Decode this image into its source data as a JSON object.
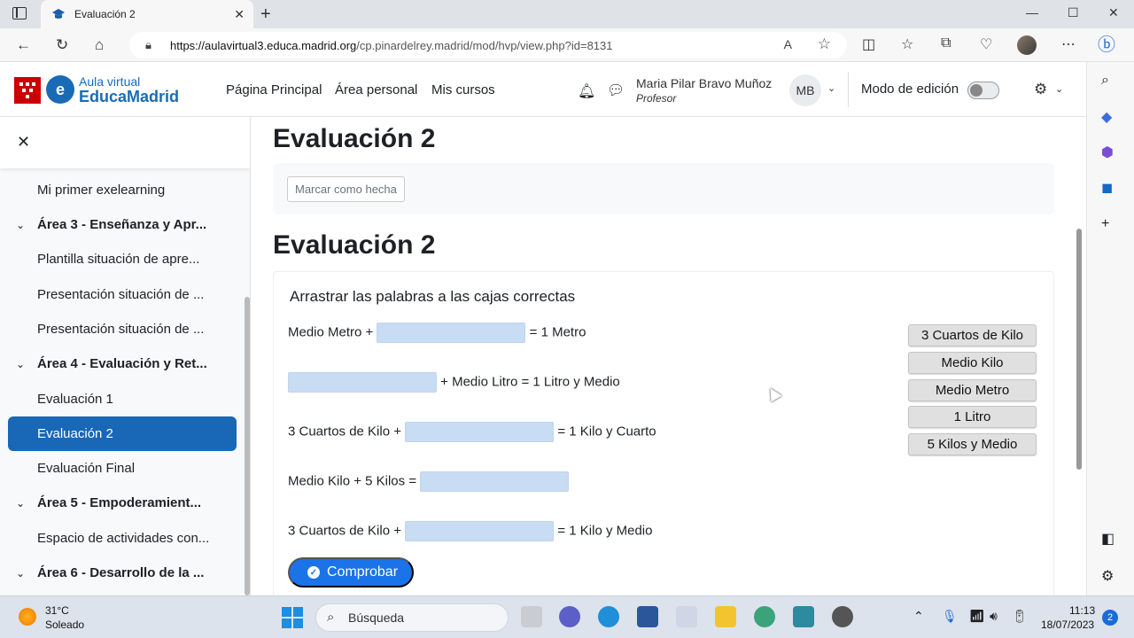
{
  "browser": {
    "tab_title": "Evaluación 2",
    "url_host": "https://aulavirtual3.educa.madrid.org",
    "url_path": "/cp.pinardelrey.madrid/mod/hvp/view.php?id=8131"
  },
  "navbar": {
    "logo_line1": "Aula virtual",
    "logo_line2": "EducaMadrid",
    "links": [
      "Página Principal",
      "Área personal",
      "Mis cursos"
    ],
    "user_name": "Maria Pilar Bravo Muñoz",
    "user_role": "Profesor",
    "user_initials": "MB",
    "edit_mode_label": "Modo de edición",
    "edit_mode_on": false
  },
  "drawer": {
    "items": [
      {
        "type": "item",
        "label": "Mi primer exelearning"
      },
      {
        "type": "section",
        "label": "Área 3 - Enseñanza y Apr..."
      },
      {
        "type": "item",
        "label": "Plantilla situación de apre..."
      },
      {
        "type": "item",
        "label": "Presentación situación de ..."
      },
      {
        "type": "item",
        "label": "Presentación situación de ..."
      },
      {
        "type": "section",
        "label": "Área 4 - Evaluación y Ret..."
      },
      {
        "type": "item",
        "label": "Evaluación 1"
      },
      {
        "type": "active",
        "label": "Evaluación 2"
      },
      {
        "type": "item",
        "label": "Evaluación Final"
      },
      {
        "type": "section",
        "label": "Área 5 - Empoderamient..."
      },
      {
        "type": "item",
        "label": "Espacio de actividades con..."
      },
      {
        "type": "section",
        "label": "Área 6 - Desarrollo de la ..."
      }
    ]
  },
  "main": {
    "page_title": "Evaluación 2",
    "mark_done_label": "Marcar como hecha",
    "activity_title": "Evaluación 2",
    "instructions": "Arrastrar las palabras a las cajas correctas",
    "rows": [
      {
        "before": "Medio Metro +",
        "after": "= 1 Metro"
      },
      {
        "before": "",
        "after": "+ Medio Litro = 1 Litro y Medio"
      },
      {
        "before": "3 Cuartos de Kilo +",
        "after": "= 1 Kilo y Cuarto"
      },
      {
        "before": "Medio Kilo + 5 Kilos =",
        "after": ""
      },
      {
        "before": "3 Cuartos de Kilo +",
        "after": "= 1 Kilo y Medio"
      }
    ],
    "words": [
      "3 Cuartos de Kilo",
      "Medio Kilo",
      "Medio Metro",
      "1 Litro",
      "5 Kilos y Medio"
    ],
    "check_label": "Comprobar"
  },
  "taskbar": {
    "temperature": "31°C",
    "weather": "Soleado",
    "search_placeholder": "Búsqueda",
    "time": "11:13",
    "date": "18/07/2023",
    "notifications": "2"
  },
  "colors": {
    "accent": "#1967b7",
    "dropzone": "#c8dcf4",
    "check_button": "#1a73e8"
  }
}
